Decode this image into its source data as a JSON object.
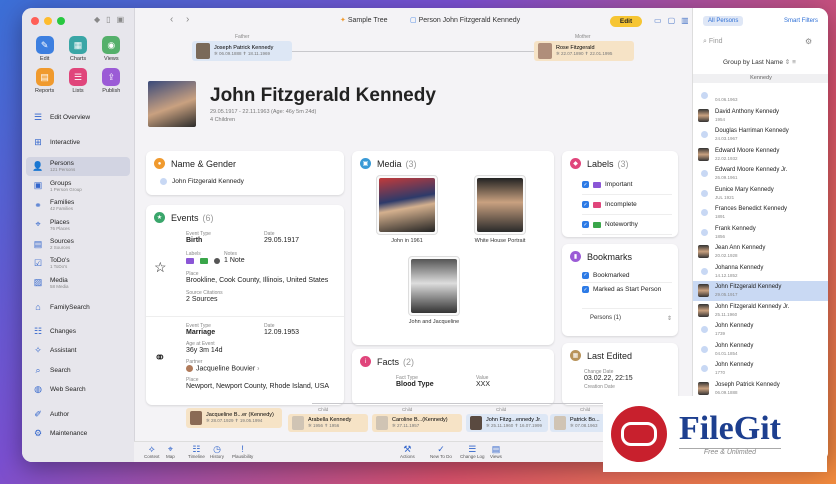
{
  "sidebar": {
    "quick": [
      {
        "label": "Edit",
        "color": "#3d7fe0",
        "glyph": "✎"
      },
      {
        "label": "Charts",
        "color": "#3aa6a6",
        "glyph": "▦"
      },
      {
        "label": "Views",
        "color": "#55b06b",
        "glyph": "◉"
      },
      {
        "label": "Reports",
        "color": "#f09a2e",
        "glyph": "▤"
      },
      {
        "label": "Lists",
        "color": "#e0457b",
        "glyph": "☰"
      },
      {
        "label": "Publish",
        "color": "#9b5bd6",
        "glyph": "⇪"
      }
    ],
    "nav": [
      {
        "label": "Edit Overview",
        "sub": "",
        "icon": "☰"
      },
      {
        "label": "Interactive",
        "sub": "",
        "icon": "⊞"
      },
      {
        "label": "Persons",
        "sub": "121 Persons",
        "icon": "👤"
      },
      {
        "label": "Groups",
        "sub": "1 Person Group",
        "icon": "▣"
      },
      {
        "label": "Families",
        "sub": "42 Families",
        "icon": "⚭"
      },
      {
        "label": "Places",
        "sub": "76 Places",
        "icon": "⌖"
      },
      {
        "label": "Sources",
        "sub": "2 Sources",
        "icon": "▤"
      },
      {
        "label": "ToDo's",
        "sub": "1 ToDo's",
        "icon": "☑"
      },
      {
        "label": "Media",
        "sub": "58 Media",
        "icon": "▨"
      },
      {
        "label": "FamilySearch",
        "sub": "",
        "icon": "⌂"
      },
      {
        "label": "Changes",
        "sub": "",
        "icon": "☷"
      },
      {
        "label": "Assistant",
        "sub": "",
        "icon": "✧"
      },
      {
        "label": "Search",
        "sub": "",
        "icon": "⌕"
      },
      {
        "label": "Web Search",
        "sub": "",
        "icon": "◍"
      },
      {
        "label": "Author",
        "sub": "",
        "icon": "✐"
      },
      {
        "label": "Maintenance",
        "sub": "",
        "icon": "⚙"
      }
    ]
  },
  "topbar": {
    "tree": "Sample Tree",
    "person": "Person John Fitzgerald Kennedy",
    "edit": "Edit"
  },
  "parents": {
    "father_label": "Father",
    "father_name": "Joseph Patrick Kennedy",
    "father_dates": "✲ 06.09.1888  ✝ 18.11.1969",
    "mother_label": "Mother",
    "mother_name": "Rose Fitzgerald",
    "mother_dates": "✲ 22.07.1890  ✝ 22.01.1995"
  },
  "person": {
    "name": "John Fitzgerald Kennedy",
    "dates": "29.05.1917 - 22.11.1963 (Age: 46y 5m 24d)",
    "children": "4 Children"
  },
  "name_gender": {
    "title": "Name & Gender",
    "value": "John Fitzgerald Kennedy"
  },
  "events": {
    "title": "Events",
    "count": "(6)",
    "birth": {
      "type_l": "Event Type",
      "type": "Birth",
      "date_l": "Date",
      "date": "29.05.1917",
      "labels_l": "Labels",
      "notes_l": "Notes",
      "notes": "1 Note",
      "place_l": "Place",
      "place": "Brookline, Cook County, Illinois, United States",
      "src_l": "Source Citations",
      "src": "2 Sources"
    },
    "marriage": {
      "type_l": "Event Type",
      "type": "Marriage",
      "date_l": "Date",
      "date": "12.09.1953",
      "age_l": "Age at Event",
      "age": "36y 3m 14d",
      "partner_l": "Partner",
      "partner": "Jacqueline Bouvier",
      "place_l": "Place",
      "place": "Newport, Newport County, Rhode Island, USA"
    }
  },
  "media": {
    "title": "Media",
    "count": "(3)",
    "items": [
      "John in 1961",
      "White House Portrait",
      "John and Jacqueline"
    ]
  },
  "facts": {
    "title": "Facts",
    "count": "(2)",
    "type_l": "Fact Type",
    "type": "Blood Type",
    "value_l": "Value",
    "value": "XXX"
  },
  "labels": {
    "title": "Labels",
    "count": "(3)",
    "items": [
      {
        "name": "Important",
        "color": "#8b56d6"
      },
      {
        "name": "Incomplete",
        "color": "#e0457b"
      },
      {
        "name": "Noteworthy",
        "color": "#3aa64a"
      }
    ]
  },
  "bookmarks": {
    "title": "Bookmarks",
    "items": [
      "Bookmarked",
      "Marked as Start Person"
    ],
    "select": "Persons (1)"
  },
  "last_edited": {
    "title": "Last Edited",
    "label": "Change Date",
    "value": "03.02.22, 22:15",
    "label2": "Creation Date"
  },
  "children": {
    "partner_label": "Partner",
    "partner": "Jacqueline B...er (Kennedy)",
    "partner_dates": "✲ 28.07.1929  ✝ 19.05.1994",
    "child_label": "Child",
    "items": [
      {
        "name": "Arabella Kennedy",
        "dates": "✲ 1956  ✝ 1956",
        "color": "#f6e3c6"
      },
      {
        "name": "Caroline B...(Kennedy)",
        "dates": "✲ 27.11.1957",
        "color": "#f6e3c6"
      },
      {
        "name": "John Fitzg...ennedy Jr.",
        "dates": "✲ 25.11.1960  ✝ 16.07.1999",
        "color": "#dde7f5"
      },
      {
        "name": "Patrick Bo...",
        "dates": "✲ 07.08.1963",
        "color": "#dde7f5"
      }
    ]
  },
  "bottom_left": [
    "Context",
    "Map",
    "Timeline",
    "History",
    "Plausibility"
  ],
  "bottom_right": [
    "Actions",
    "New To Do",
    "Change Log",
    "Views"
  ],
  "right_panel": {
    "tab_all": "All Persons",
    "tab_smart": "Smart Filters",
    "find": "Find",
    "group": "Group by Last Name",
    "header": "Kennedy",
    "persons": [
      {
        "n": "",
        "d": "04.06.1963",
        "photo": false
      },
      {
        "n": "David Anthony Kennedy",
        "d": "1954",
        "photo": true
      },
      {
        "n": "Douglas Harriman Kennedy",
        "d": "24.03.1967",
        "photo": false
      },
      {
        "n": "Edward Moore Kennedy",
        "d": "22.02.1932",
        "photo": true
      },
      {
        "n": "Edward Moore Kennedy Jr.",
        "d": "26.09.1961",
        "photo": false
      },
      {
        "n": "Eunice Mary Kennedy",
        "d": "JUL 1921",
        "photo": false
      },
      {
        "n": "Frances Benedict Kennedy",
        "d": "1891",
        "photo": false
      },
      {
        "n": "Frank Kennedy",
        "d": "1856",
        "photo": false
      },
      {
        "n": "Jean Ann Kennedy",
        "d": "20.02.1928",
        "photo": true
      },
      {
        "n": "Johanna Kennedy",
        "d": "14.12.1852",
        "photo": false
      },
      {
        "n": "John Fitzgerald Kennedy",
        "d": "29.05.1917",
        "photo": true,
        "sel": true
      },
      {
        "n": "John Fitzgerald Kennedy Jr.",
        "d": "25.11.1960",
        "photo": true
      },
      {
        "n": "John Kennedy",
        "d": "1739",
        "photo": false
      },
      {
        "n": "John Kennedy",
        "d": "04.01.1854",
        "photo": false
      },
      {
        "n": "John Kennedy",
        "d": "1770",
        "photo": false
      },
      {
        "n": "Joseph Patrick Kennedy",
        "d": "06.09.1888",
        "photo": true
      },
      {
        "n": "Joseph Patrick Kennedy",
        "d": "",
        "photo": false
      }
    ]
  },
  "watermark": {
    "brand": "FileGit",
    "tagline": "Free & Unlimited"
  }
}
